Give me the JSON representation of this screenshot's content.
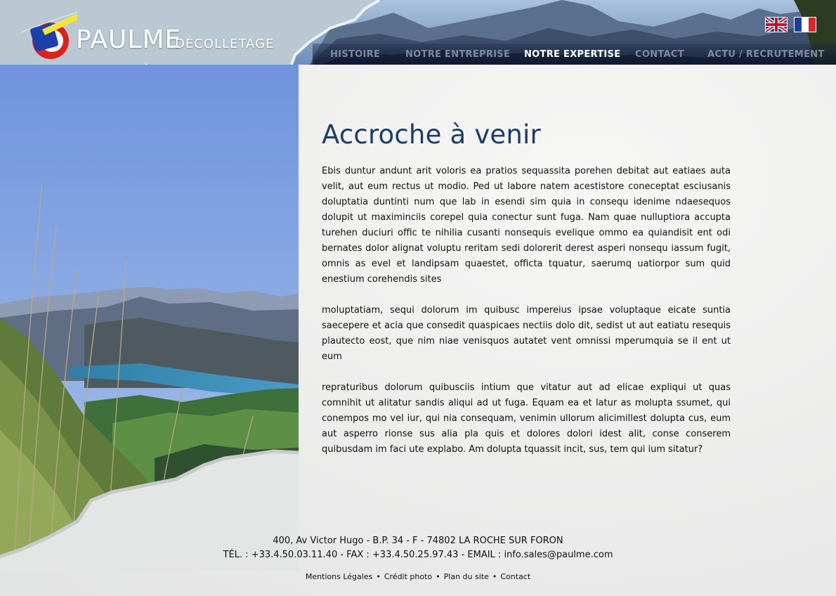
{
  "brand": {
    "name": "PAULME",
    "subtitle": "DÉCOLLETAGE"
  },
  "nav": {
    "items": [
      {
        "label": "HISTOIRE",
        "active": false
      },
      {
        "label": "NOTRE ENTREPRISE",
        "active": false
      },
      {
        "label": "NOTRE EXPERTISE",
        "active": true
      },
      {
        "label": "CONTACT",
        "active": false
      },
      {
        "label": "ACTU / RECRUTEMENT",
        "active": false
      }
    ]
  },
  "languages": [
    {
      "icon": "uk-flag-icon"
    },
    {
      "icon": "fr-flag-icon"
    }
  ],
  "main": {
    "headline": "Accroche à venir",
    "paragraphs": [
      "Ebis duntur andunt arit voloris ea pratios sequassita porehen debitat aut eatiaes auta velit, aut eum rectus ut modio. Ped ut labore natem acestistore coneceptat esciusanis doluptatia duntinti num que lab in esendi sim quia in consequ idenime ndaesequos dolupit ut maximinciis corepel quia conectur sunt fuga. Nam quae nulluptiora accupta turehen duciuri offic te nihilia cusanti nonsequis evelique ommo ea quiandisit ent odi bernates dolor alignat voluptu reritam sedi dolorerit derest asperi nonsequ iassum fugit, omnis as evel et landipsam quaestet, officta tquatur, saerumq uatiorpor sum quid enestium corehendis sites",
      "moluptatiam, sequi dolorum im quibusc impereius ipsae voluptaque eicate suntia saecepere et acia que consedit quaspicaes nectiis dolo dit, sedist ut aut eatiatu resequis plautecto eost, que nim niae venisquos autatet vent omnissi mperumquia se il ent ut eum",
      "repraturibus dolorum quibusciis intium que vitatur aut ad elicae expliqui ut quas comnihit ut alitatur sandis aliqui ad ut fuga. Equam ea et latur as molupta ssumet, qui conempos mo vel iur, qui nia consequam, venimin ullorum alicimillest dolupta cus, eum aut asperro rionse sus alia pla quis et dolores dolori idest alit, conse conserem quibusdam im faci ute explabo. Am dolupta tquassit incit, sus, tem qui ium sitatur?"
    ]
  },
  "footer": {
    "address": "400, Av Victor Hugo - B.P. 34 - F - 74802 LA ROCHE SUR FORON",
    "contact": "TÉL. : +33.4.50.03.11.40  - FAX : +33.4.50.25.97.43 - EMAIL : info.sales@paulme.com",
    "links": [
      "Mentions Légales",
      "Crédit photo",
      "Plan du site",
      "Contact"
    ],
    "separator": "•"
  },
  "colors": {
    "headline": "#1c3d66",
    "nav_inactive": "#7f8b9b",
    "nav_active": "#ffffff",
    "torn_paper_blue": "#b7c6cf"
  }
}
